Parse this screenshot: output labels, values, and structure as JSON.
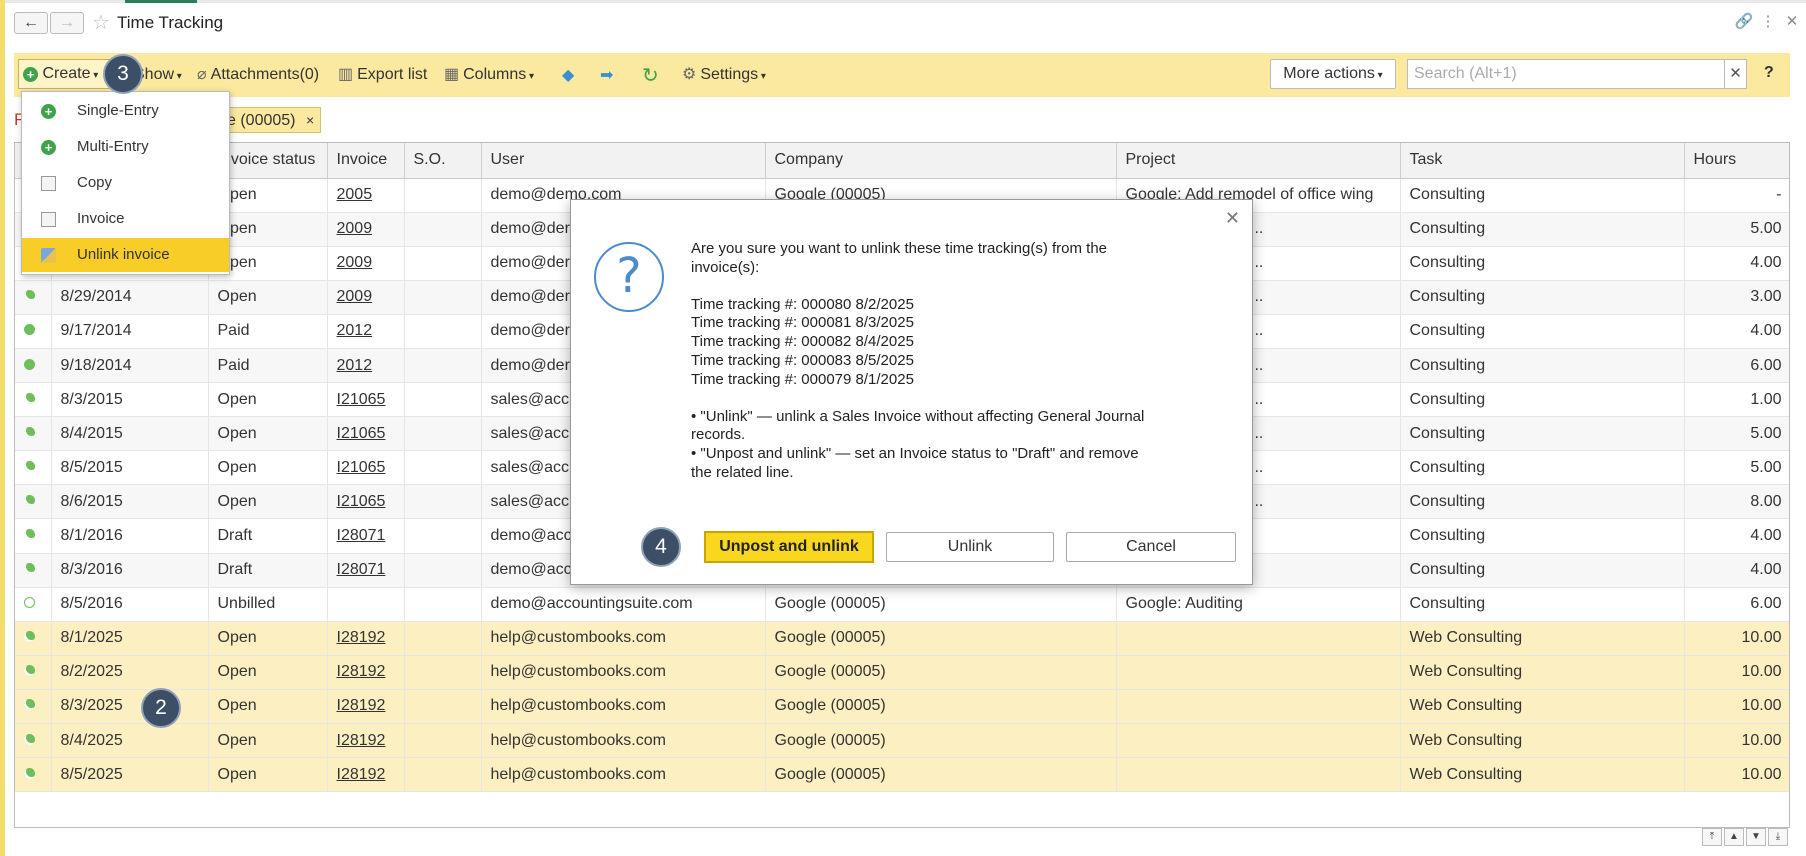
{
  "window": {
    "title": "Time Tracking"
  },
  "toolbar": {
    "create": "Create",
    "show": "Show",
    "attachments": "Attachments(0)",
    "export": "Export list",
    "columns": "Columns",
    "settings": "Settings",
    "more_actions": "More actions",
    "search_placeholder": "Search (Alt+1)",
    "help": "?"
  },
  "filter": {
    "prefix": "F",
    "chip": "e (00005)"
  },
  "create_menu": {
    "items": [
      {
        "label": "Single-Entry",
        "icon": "add-icon"
      },
      {
        "label": "Multi-Entry",
        "icon": "add-icon"
      },
      {
        "label": "Copy",
        "icon": "copy-icon"
      },
      {
        "label": "Invoice",
        "icon": "document-icon"
      },
      {
        "label": "Unlink invoice",
        "icon": "unlink-icon"
      }
    ]
  },
  "table": {
    "columns": [
      "",
      "",
      "Invoice status",
      "Invoice",
      "S.O.",
      "User",
      "Company",
      "Project",
      "Task",
      "Hours"
    ],
    "rows": [
      {
        "status": "clock",
        "date": "",
        "inv_status": "Open",
        "invoice": "2005",
        "so": "",
        "user": "demo@demo.com",
        "company": "Google (00005)",
        "project": "Google: Add remodel of office wing",
        "task": "Consulting",
        "hours": "-",
        "selected": false
      },
      {
        "status": "clock",
        "date": "",
        "inv_status": "Open",
        "invoice": "2009",
        "so": "",
        "user": "demo@der",
        "company": "",
        "project": "f San Francisco o...",
        "task": "Consulting",
        "hours": "5.00",
        "selected": false
      },
      {
        "status": "clock",
        "date": "",
        "inv_status": "Open",
        "invoice": "2009",
        "so": "",
        "user": "demo@der",
        "company": "",
        "project": "f San Francisco o...",
        "task": "Consulting",
        "hours": "4.00",
        "selected": false
      },
      {
        "status": "clock",
        "date": "8/29/2014",
        "inv_status": "Open",
        "invoice": "2009",
        "so": "",
        "user": "demo@der",
        "company": "",
        "project": "f San Francisco o...",
        "task": "Consulting",
        "hours": "3.00",
        "selected": false
      },
      {
        "status": "paid",
        "date": "9/17/2014",
        "inv_status": "Paid",
        "invoice": "2012",
        "so": "",
        "user": "demo@der",
        "company": "",
        "project": "f San Francisco o...",
        "task": "Consulting",
        "hours": "4.00",
        "selected": false
      },
      {
        "status": "paid",
        "date": "9/18/2014",
        "inv_status": "Paid",
        "invoice": "2012",
        "so": "",
        "user": "demo@der",
        "company": "",
        "project": "f San Francisco o...",
        "task": "Consulting",
        "hours": "6.00",
        "selected": false
      },
      {
        "status": "clock",
        "date": "8/3/2015",
        "inv_status": "Open",
        "invoice": "I21065",
        "so": "",
        "user": "sales@acc",
        "company": "",
        "project": "f San Francisco o...",
        "task": "Consulting",
        "hours": "1.00",
        "selected": false
      },
      {
        "status": "clock",
        "date": "8/4/2015",
        "inv_status": "Open",
        "invoice": "I21065",
        "so": "",
        "user": "sales@acc",
        "company": "",
        "project": "f San Francisco o...",
        "task": "Consulting",
        "hours": "5.00",
        "selected": false
      },
      {
        "status": "clock",
        "date": "8/5/2015",
        "inv_status": "Open",
        "invoice": "I21065",
        "so": "",
        "user": "sales@acc",
        "company": "",
        "project": "f San Francisco o...",
        "task": "Consulting",
        "hours": "5.00",
        "selected": false
      },
      {
        "status": "clock",
        "date": "8/6/2015",
        "inv_status": "Open",
        "invoice": "I21065",
        "so": "",
        "user": "sales@acc",
        "company": "",
        "project": "f San Francisco o...",
        "task": "Consulting",
        "hours": "8.00",
        "selected": false
      },
      {
        "status": "clock",
        "date": "8/1/2016",
        "inv_status": "Draft",
        "invoice": "I28071",
        "so": "",
        "user": "demo@acc",
        "company": "",
        "project": "",
        "task": "Consulting",
        "hours": "4.00",
        "selected": false
      },
      {
        "status": "clock",
        "date": "8/3/2016",
        "inv_status": "Draft",
        "invoice": "I28071",
        "so": "",
        "user": "demo@acc",
        "company": "",
        "project": "",
        "task": "Consulting",
        "hours": "4.00",
        "selected": false
      },
      {
        "status": "open",
        "date": "8/5/2016",
        "inv_status": "Unbilled",
        "invoice": "",
        "so": "",
        "user": "demo@accountingsuite.com",
        "company": "Google (00005)",
        "project": "Google: Auditing",
        "task": "Consulting",
        "hours": "6.00",
        "selected": false
      },
      {
        "status": "clock",
        "date": "8/1/2025",
        "inv_status": "Open",
        "invoice": "I28192",
        "so": "",
        "user": "help@custombooks.com",
        "company": "Google (00005)",
        "project": "",
        "task": "Web Consulting",
        "hours": "10.00",
        "selected": true
      },
      {
        "status": "clock",
        "date": "8/2/2025",
        "inv_status": "Open",
        "invoice": "I28192",
        "so": "",
        "user": "help@custombooks.com",
        "company": "Google (00005)",
        "project": "",
        "task": "Web Consulting",
        "hours": "10.00",
        "selected": true
      },
      {
        "status": "clock",
        "date": "8/3/2025",
        "inv_status": "Open",
        "invoice": "I28192",
        "so": "",
        "user": "help@custombooks.com",
        "company": "Google (00005)",
        "project": "",
        "task": "Web Consulting",
        "hours": "10.00",
        "selected": true
      },
      {
        "status": "clock",
        "date": "8/4/2025",
        "inv_status": "Open",
        "invoice": "I28192",
        "so": "",
        "user": "help@custombooks.com",
        "company": "Google (00005)",
        "project": "",
        "task": "Web Consulting",
        "hours": "10.00",
        "selected": true
      },
      {
        "status": "clock",
        "date": "8/5/2025",
        "inv_status": "Open",
        "invoice": "I28192",
        "so": "",
        "user": "help@custombooks.com",
        "company": "Google (00005)",
        "project": "",
        "task": "Web Consulting",
        "hours": "10.00",
        "selected": true
      }
    ]
  },
  "dialog": {
    "question": "Are you sure you want to unlink these time tracking(s) from the invoice(s):",
    "entries": [
      "Time tracking #: 000080 8/2/2025",
      "Time tracking #: 000081 8/3/2025",
      "Time tracking #: 000082 8/4/2025",
      "Time tracking #: 000083 8/5/2025",
      "Time tracking #: 000079 8/1/2025"
    ],
    "note_unlink": " • \"Unlink\" — unlink a Sales Invoice without affecting General Journal records.",
    "note_unpost": " • \"Unpost and unlink\" — set an Invoice status to \"Draft\" and remove the related line.",
    "btn_unpost": "Unpost and unlink",
    "btn_unlink": "Unlink",
    "btn_cancel": "Cancel"
  },
  "badges": {
    "step2": "2",
    "step3": "3",
    "step4": "4"
  },
  "colors": {
    "toolbar_bg": "#fbe9a0",
    "selected_row": "#fcf0c2",
    "primary_button": "#f8d71e",
    "status_green": "#6cbf59"
  }
}
